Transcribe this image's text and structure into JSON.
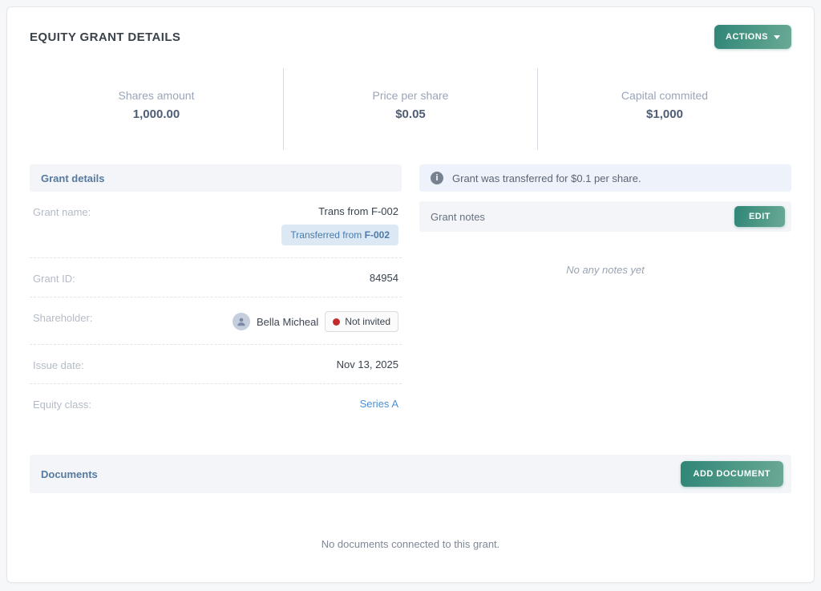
{
  "header": {
    "title": "EQUITY GRANT DETAILS",
    "actions_label": "ACTIONS"
  },
  "stats": [
    {
      "label": "Shares amount",
      "value": "1,000.00"
    },
    {
      "label": "Price per share",
      "value": "$0.05"
    },
    {
      "label": "Capital commited",
      "value": "$1,000"
    }
  ],
  "grant_details": {
    "section_title": "Grant details",
    "grant_name": {
      "label": "Grant name:",
      "value": "Trans from F-002",
      "badge_prefix": "Transferred from ",
      "badge_code": "F-002"
    },
    "grant_id": {
      "label": "Grant ID:",
      "value": "84954"
    },
    "shareholder": {
      "label": "Shareholder:",
      "name": "Bella Micheal",
      "status": "Not invited"
    },
    "issue_date": {
      "label": "Issue date:",
      "value": "Nov 13, 2025"
    },
    "equity_class": {
      "label": "Equity class:",
      "value": "Series A"
    }
  },
  "notes": {
    "info_banner": "Grant was transferred for $0.1 per share.",
    "section_title": "Grant notes",
    "edit_label": "EDIT",
    "empty_text": "No any notes yet"
  },
  "documents": {
    "section_title": "Documents",
    "add_label": "ADD DOCUMENT",
    "empty_text": "No documents connected to this grant."
  },
  "colors": {
    "accent_start": "#2f8677",
    "accent_end": "#6aa995",
    "link": "#4a90d9",
    "status_dot": "#c42b2b",
    "info_banner_bg": "#edf2fb",
    "section_bar_bg": "#f3f5f8",
    "transfer_badge_bg": "#dce9f5"
  }
}
